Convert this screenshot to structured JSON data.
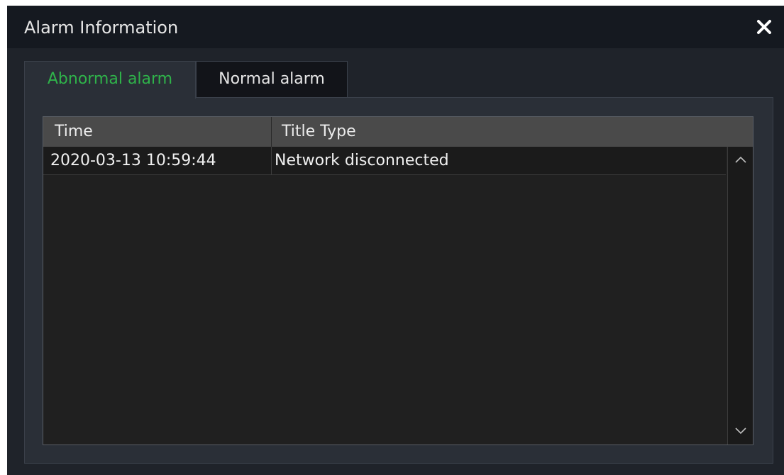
{
  "window": {
    "title": "Alarm Information",
    "close_icon": "close-icon"
  },
  "tabs": [
    {
      "label": "Abnormal alarm",
      "active": true
    },
    {
      "label": "Normal alarm",
      "active": false
    }
  ],
  "table": {
    "columns": [
      "Time",
      "Title Type"
    ],
    "rows": [
      {
        "time": "2020-03-13 10:59:44",
        "title_type": "Network disconnected"
      }
    ]
  },
  "scrollbar": {
    "up_icon": "chevron-up-icon",
    "down_icon": "chevron-down-icon"
  },
  "colors": {
    "active_tab_text": "#2fb34a",
    "titlebar": "#151920",
    "panel": "#2a2f37"
  }
}
